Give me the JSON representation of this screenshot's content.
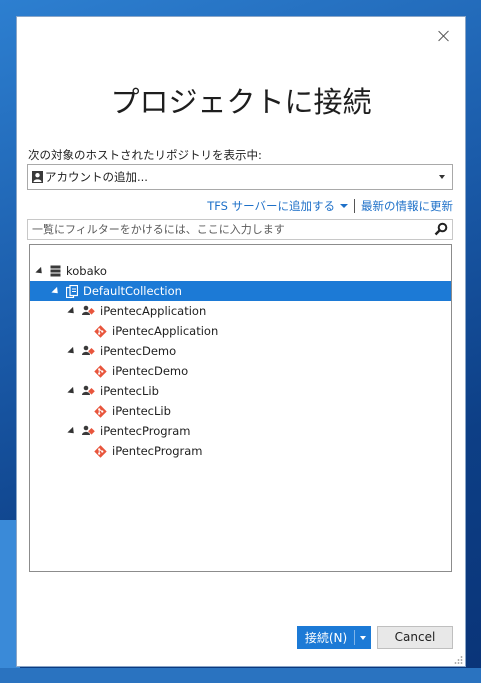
{
  "dialog": {
    "title": "プロジェクトに接続",
    "repo_label": "次の対象のホストされたリポジトリを表示中:",
    "account_combo": "アカウントの追加...",
    "links": {
      "add_tfs": "TFS サーバーに追加する",
      "refresh": "最新の情報に更新"
    },
    "filter": {
      "placeholder": "一覧にフィルターをかけるには、ここに入力します"
    },
    "tree": {
      "server": "kobako",
      "collection": "DefaultCollection",
      "projects": [
        {
          "name": "iPentecApplication",
          "repo": "iPentecApplication"
        },
        {
          "name": "iPentecDemo",
          "repo": "iPentecDemo"
        },
        {
          "name": "iPentecLib",
          "repo": "iPentecLib"
        },
        {
          "name": "iPentecProgram",
          "repo": "iPentecProgram"
        }
      ]
    },
    "buttons": {
      "connect": "接続(N)",
      "cancel": "Cancel"
    }
  },
  "colors": {
    "accent": "#1c7ad6",
    "link": "#1e70c8",
    "git": "#e8553c"
  }
}
